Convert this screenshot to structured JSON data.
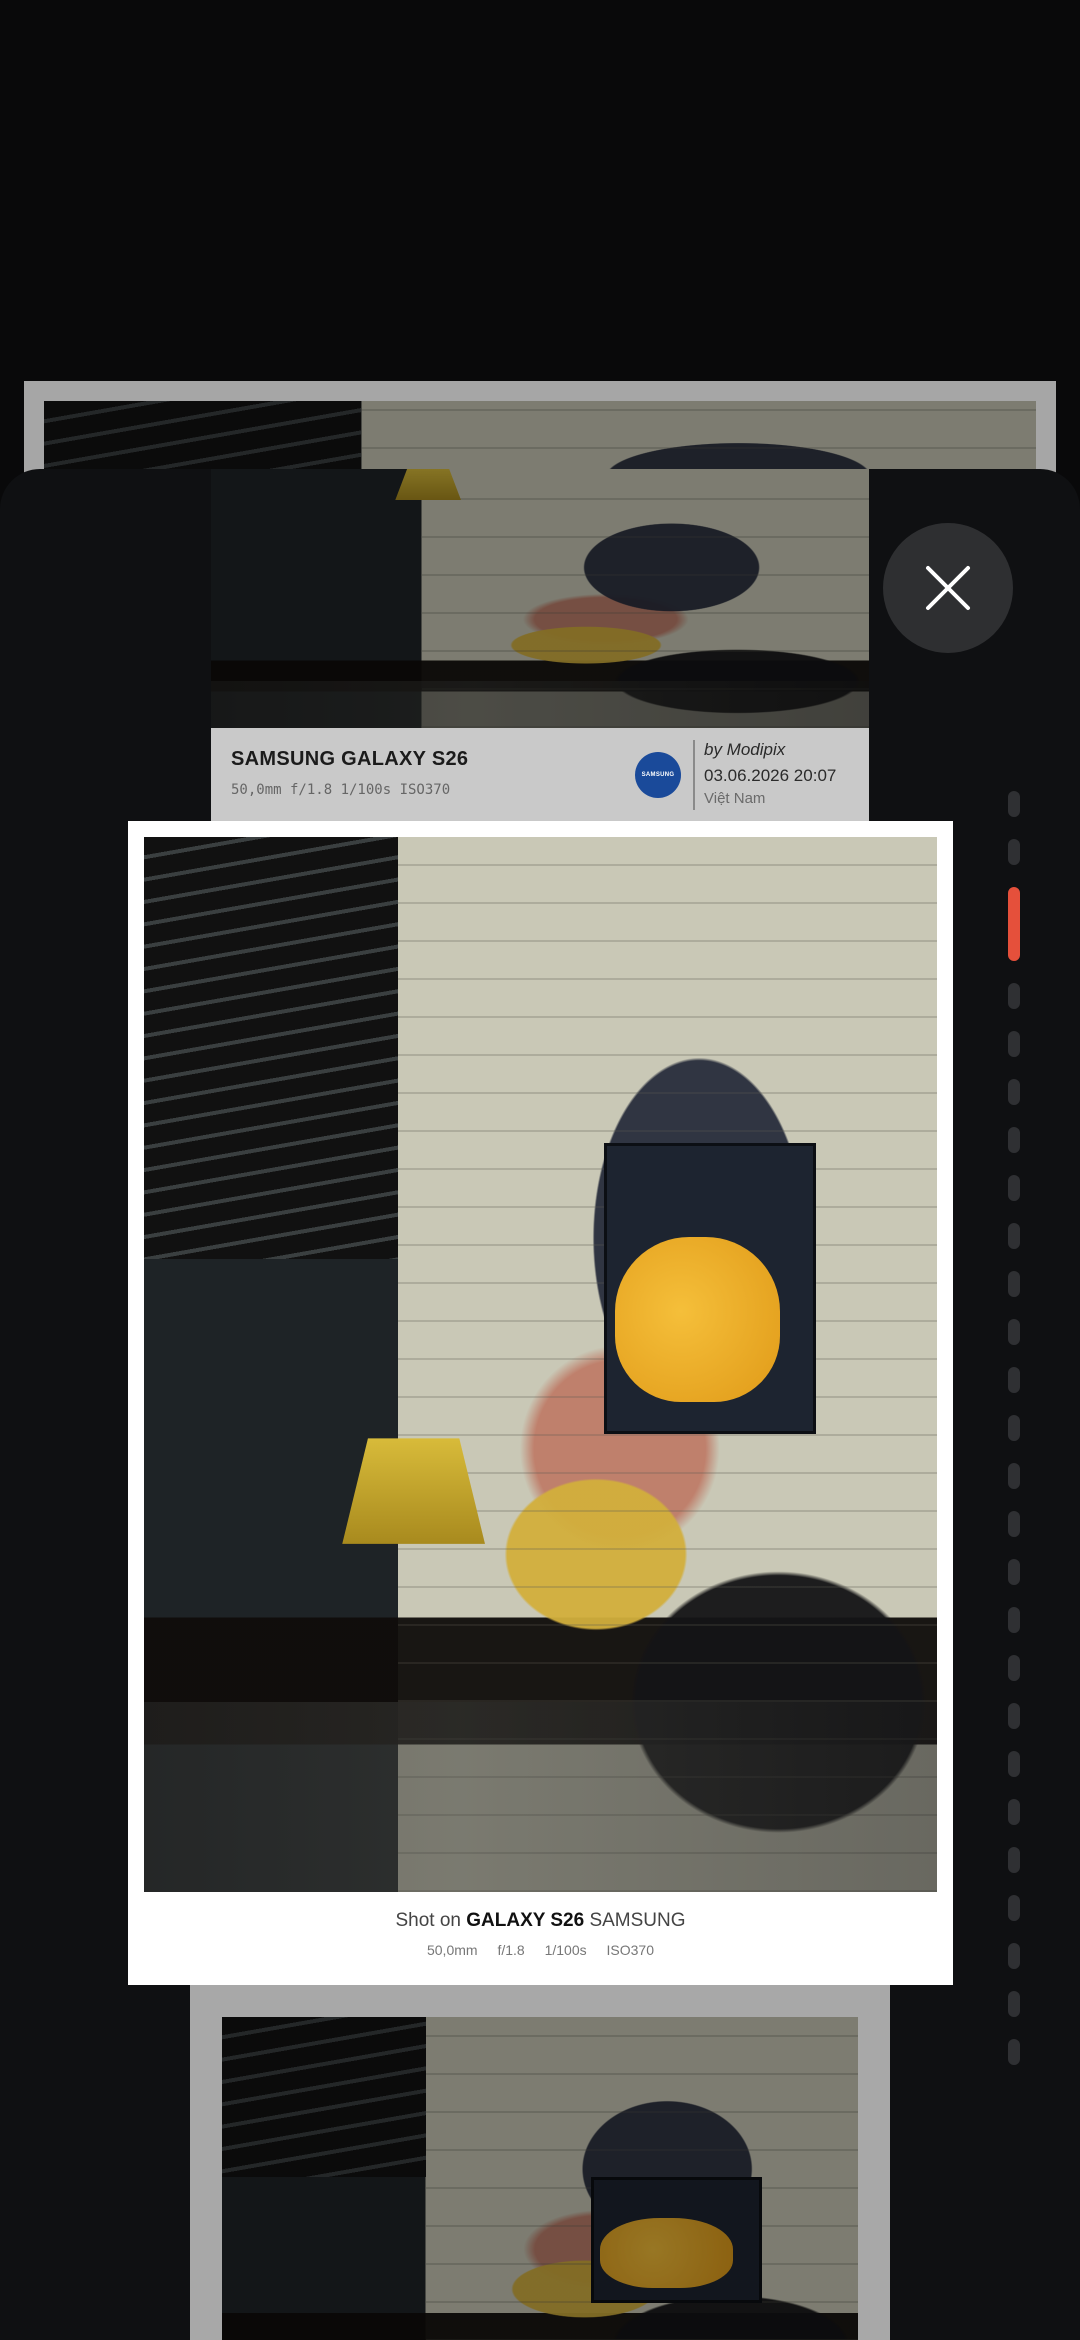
{
  "close_button": {
    "icon": "close-icon"
  },
  "previous_card": {
    "model": "SAMSUNG GALAXY S26",
    "specs": "50,0mm f/1.8 1/100s ISO370",
    "brand_logo": "SAMSUNG",
    "author": "by Modipix",
    "datetime": "03.06.2026 20:07",
    "location": "Việt Nam"
  },
  "main_card": {
    "shot_prefix": "Shot on",
    "model": "GALAXY S26",
    "brand": "SAMSUNG",
    "specs": [
      "50,0mm",
      "f/1.8",
      "1/100s",
      "ISO370"
    ]
  },
  "page_indicator": {
    "total": 26,
    "active_index": 2
  },
  "colors": {
    "accent": "#e5503b",
    "sheet": "#0f1012",
    "card": "#ffffff"
  }
}
